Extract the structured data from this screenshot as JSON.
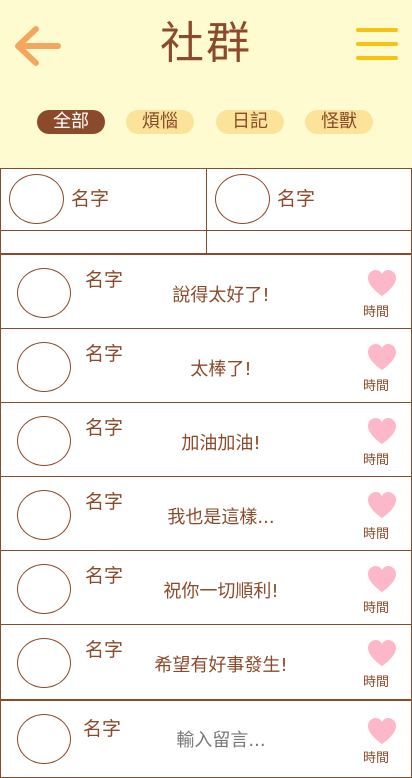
{
  "header": {
    "title": "社群"
  },
  "tabs": [
    {
      "label": "全部",
      "active": true
    },
    {
      "label": "煩惱",
      "active": false
    },
    {
      "label": "日記",
      "active": false
    },
    {
      "label": "怪獸",
      "active": false
    }
  ],
  "grid": {
    "cells": [
      {
        "name": "名字"
      },
      {
        "name": "名字"
      }
    ]
  },
  "comments": [
    {
      "name": "名字",
      "text": "說得太好了!",
      "time": "時間"
    },
    {
      "name": "名字",
      "text": "太棒了!",
      "time": "時間"
    },
    {
      "name": "名字",
      "text": "加油加油!",
      "time": "時間"
    },
    {
      "name": "名字",
      "text": "我也是這樣...",
      "time": "時間"
    },
    {
      "name": "名字",
      "text": "祝你一切順利!",
      "time": "時間"
    },
    {
      "name": "名字",
      "text": "希望有好事發生!",
      "time": "時間"
    }
  ],
  "composer": {
    "name": "名字",
    "placeholder": "輸入留言...",
    "time": "時間"
  },
  "colors": {
    "brown": "#8b4a2b",
    "header_bg": "#fffbd1",
    "tab_bg": "#fbe49a",
    "menu_yellow": "#f6c312",
    "back_orange": "#f4a65e",
    "heart_pink": "#fcb8c8"
  },
  "icons": {
    "back": "arrow-left-icon",
    "menu": "hamburger-menu-icon",
    "like": "heart-icon"
  }
}
